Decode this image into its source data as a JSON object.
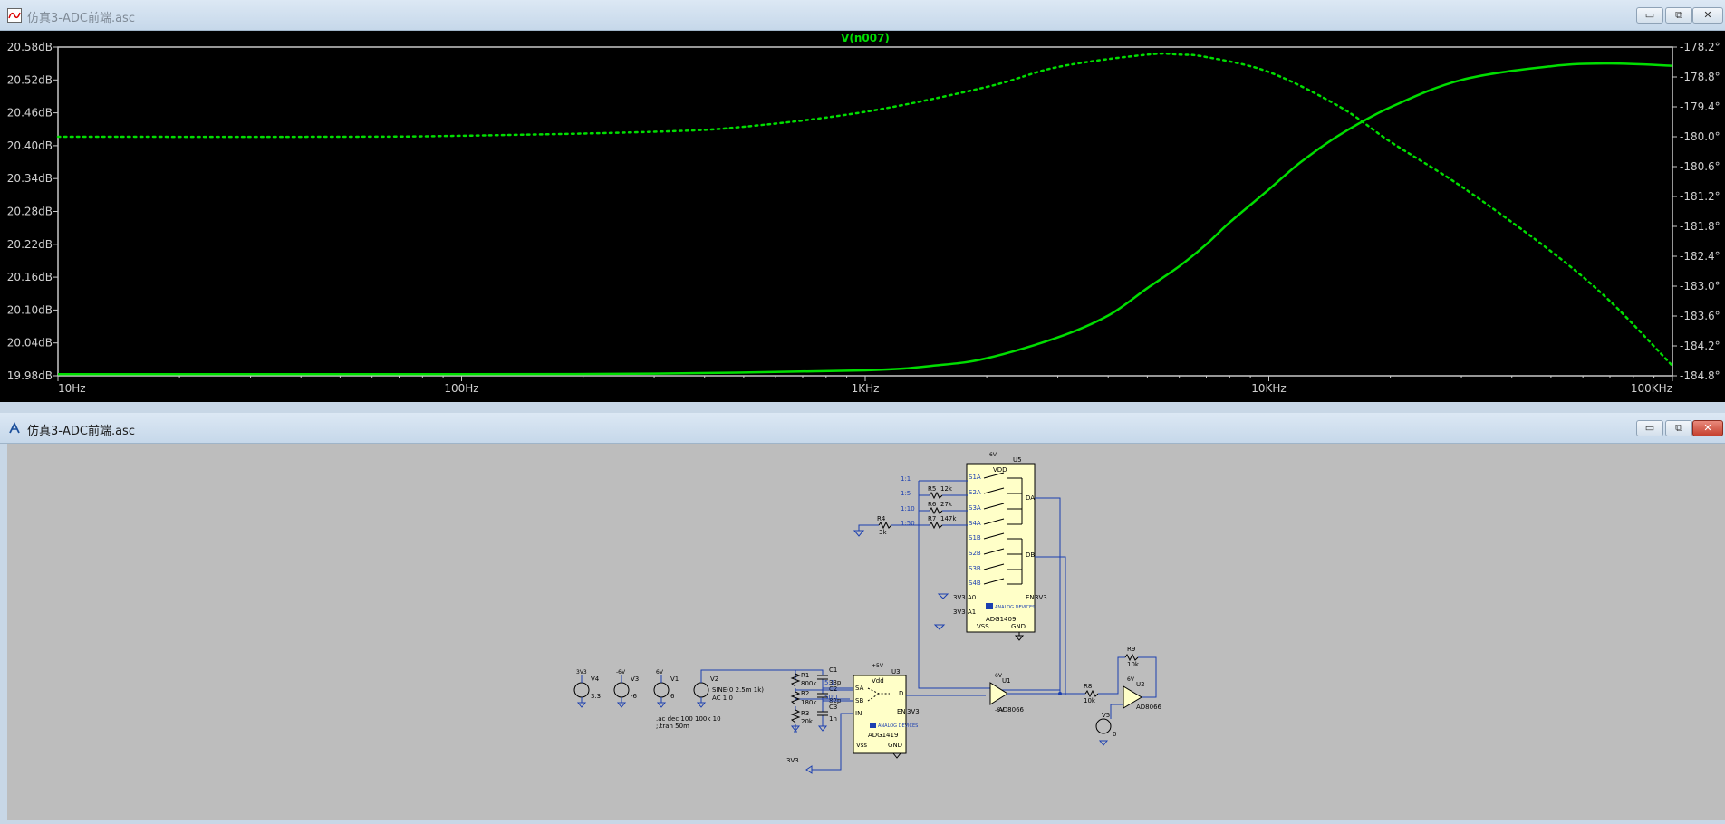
{
  "waveform_window": {
    "title": "仿真3-ADC前端.asc",
    "buttons": {
      "minimize": "▭",
      "maximize": "⧉",
      "close": "✕"
    },
    "icon": "waveform-icon"
  },
  "chart_data": {
    "type": "line",
    "title": "V(n007)",
    "x_scale": "log",
    "xlim": [
      10,
      100000
    ],
    "x_ticks": [
      10,
      100,
      1000,
      10000,
      100000
    ],
    "x_tick_labels": [
      "10Hz",
      "100Hz",
      "1KHz",
      "10KHz",
      "100KHz"
    ],
    "y_left_ticks": [
      "20.58dB",
      "20.52dB",
      "20.46dB",
      "20.40dB",
      "20.34dB",
      "20.28dB",
      "20.22dB",
      "20.16dB",
      "20.10dB",
      "20.04dB",
      "19.98dB"
    ],
    "y_left_lim": [
      19.98,
      20.58
    ],
    "y_right_ticks": [
      "-178.2°",
      "-178.8°",
      "-179.4°",
      "-180.0°",
      "-180.6°",
      "-181.2°",
      "-181.8°",
      "-182.4°",
      "-183.0°",
      "-183.6°",
      "-184.2°",
      "-184.8°"
    ],
    "y_right_lim": [
      -184.8,
      -178.2
    ],
    "trace_color": "#00dd00",
    "grid": false,
    "series": [
      {
        "name": "V(n007)",
        "quantity": "magnitude",
        "units": "dB",
        "style": "solid",
        "x": [
          10,
          100,
          300,
          1000,
          1500,
          2000,
          3000,
          4000,
          5000,
          6000,
          7000,
          8000,
          10000,
          12000,
          15000,
          20000,
          30000,
          50000,
          70000,
          100000
        ],
        "values": [
          19.983,
          19.983,
          19.984,
          19.99,
          19.999,
          20.012,
          20.05,
          20.09,
          20.14,
          20.18,
          20.22,
          20.26,
          20.32,
          20.37,
          20.42,
          20.47,
          20.52,
          20.545,
          20.55,
          20.546
        ]
      },
      {
        "name": "V(n007)",
        "quantity": "phase",
        "units": "deg",
        "style": "dotted",
        "x": [
          10,
          50,
          100,
          300,
          500,
          1000,
          2000,
          3000,
          5000,
          6000,
          7000,
          10000,
          15000,
          20000,
          30000,
          50000,
          70000,
          100000
        ],
        "values": [
          -180.0,
          -180.0,
          -179.98,
          -179.9,
          -179.8,
          -179.5,
          -179.0,
          -178.6,
          -178.35,
          -178.35,
          -178.4,
          -178.7,
          -179.4,
          -180.1,
          -181.0,
          -182.3,
          -183.3,
          -184.6
        ]
      }
    ]
  },
  "schematic_window": {
    "title": "仿真3-ADC前端.asc",
    "buttons": {
      "minimize": "▭",
      "maximize": "⧉",
      "close": "✕"
    },
    "icon": "schematic-icon",
    "components": {
      "u5_name": "U5",
      "u5_vdd": "VDD",
      "u5_part": "ADG1409",
      "u5_pins": [
        "S1A",
        "S2A",
        "S3A",
        "S4A",
        "S1B",
        "S2B",
        "S3B",
        "S4B"
      ],
      "u5_da": "DA",
      "u5_db": "DB",
      "u5_en": "EN",
      "u5_en_net": "3V3",
      "u5_a0": "A0",
      "u5_a1": "A1",
      "u5_a0_net": "3V3",
      "u5_a1_net": "3V3",
      "u5_vss": "VSS",
      "u5_gnd": "GND",
      "u5_vdd_net": "6V",
      "ratio_labels": [
        "1:1",
        "1:5",
        "1:10",
        "1:50"
      ],
      "r5": "R5",
      "r5_val": "12k",
      "r6": "R6",
      "r6_val": "27k",
      "r7": "R7",
      "r7_val": "147k",
      "r4": "R4",
      "r4_val": "3k",
      "v4": "V4",
      "v4_net": "3V3",
      "v4_val": "3.3",
      "v3": "V3",
      "v3_net": "-6V",
      "v3_val": "-6",
      "v1": "V1",
      "v1_net": "6V",
      "v1_val": "6",
      "v2": "V2",
      "v2_val1": "SINE(0 2.5m 1k)",
      "v2_val2": "AC 1 0",
      "r1": "R1",
      "r1_val": "800k",
      "r2": "R2",
      "r2_val": "180k",
      "r3": "R3",
      "r3_val": "20k",
      "c1": "C1",
      "c1_val": "33p",
      "c2": "C2",
      "c2_val": "82p",
      "c3": "C3",
      "c3_val": "1n",
      "spice1": ".ac dec 100 100k 10",
      "spice2": ";.tran 50m",
      "u3_name": "U3",
      "u3_part": "ADG1419",
      "u3_vdd": "Vdd",
      "u3_sa": "SA",
      "u3_sb": "SB",
      "u3_in": "IN",
      "u3_d": "D",
      "u3_en": "EN",
      "u3_en_net": "3V3",
      "u3_vss": "Vss",
      "u3_gnd": "GND",
      "u3_vdd_net": "+5V",
      "net_51": "5:1",
      "net_501": "50:1",
      "net_3v3": "3V3",
      "u1": "U1",
      "u1_part": "AD8066",
      "u2": "U2",
      "u2_part": "AD8066",
      "r8": "R8",
      "r8_val": "10k",
      "r9": "R9",
      "r9_val": "10k",
      "v5": "V5",
      "v5_val": "0",
      "pos6v": "6V",
      "neg6v": "-6V",
      "logo": "ANALOG DEVICES"
    }
  }
}
